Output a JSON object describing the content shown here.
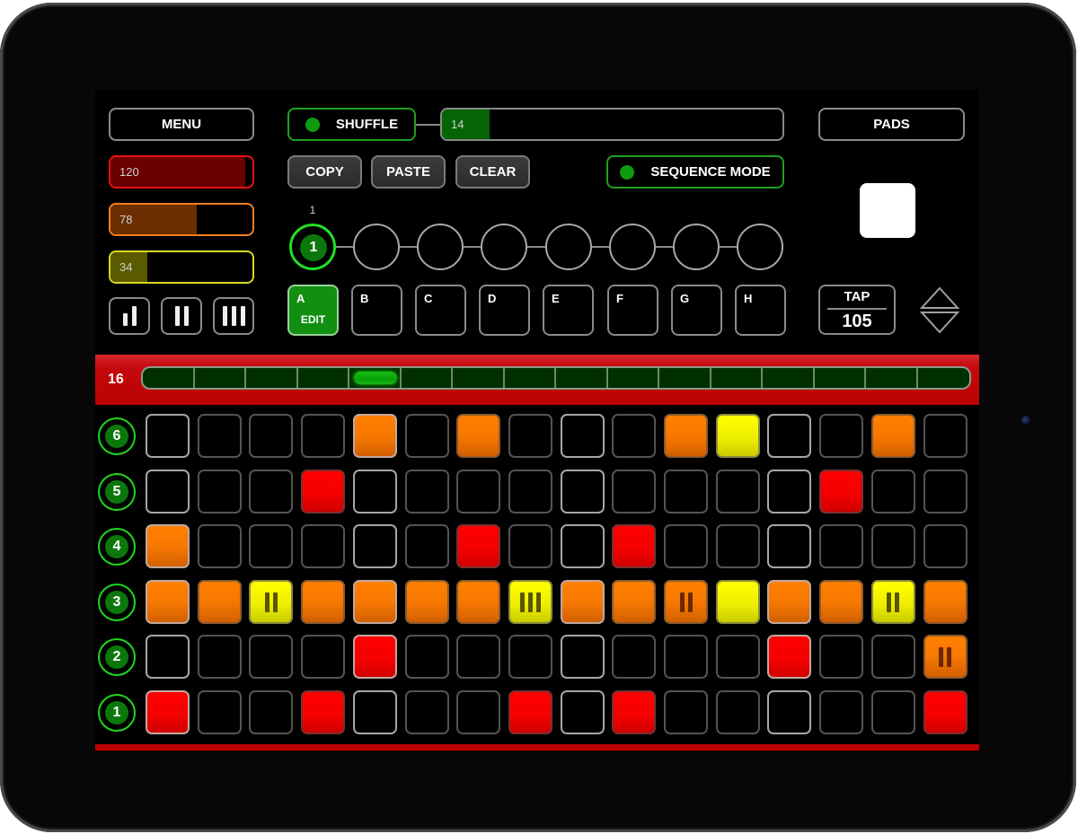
{
  "header": {
    "menu_label": "MENU",
    "pads_label": "PADS",
    "shuffle": {
      "label": "SHUFFLE",
      "on": true,
      "value": "14",
      "fraction": 0.14
    },
    "copy_label": "COPY",
    "paste_label": "PASTE",
    "clear_label": "CLEAR",
    "sequence_mode": {
      "label": "SEQUENCE MODE",
      "on": true
    }
  },
  "sliders": [
    {
      "name": "red",
      "value": "120",
      "fraction": 0.95,
      "border": "#e81010",
      "fill": "#6a0000"
    },
    {
      "name": "orange",
      "value": "78",
      "fraction": 0.61,
      "border": "#f08020",
      "fill": "#6a2e00"
    },
    {
      "name": "yellow",
      "value": "34",
      "fraction": 0.26,
      "border": "#d8d820",
      "fill": "#5a5a00"
    }
  ],
  "voice_buttons": [
    {
      "name": "single",
      "bars": 1
    },
    {
      "name": "double",
      "bars": 2
    },
    {
      "name": "triple",
      "bars": 3
    }
  ],
  "chain": {
    "current_label": "1",
    "slots": [
      "1",
      "",
      "",
      "",
      "",
      "",
      "",
      ""
    ]
  },
  "patterns": {
    "items": [
      "A",
      "B",
      "C",
      "D",
      "E",
      "F",
      "G",
      "H"
    ],
    "active_index": 0,
    "edit_label": "EDIT"
  },
  "tempo": {
    "tap_label": "TAP",
    "bpm": "105"
  },
  "steps": {
    "count_label": "16",
    "total": 16,
    "playhead_index": 4
  },
  "grid": {
    "rows": [
      {
        "label": "6",
        "cells": [
          "",
          "",
          "",
          "",
          "orange",
          "",
          "orange",
          "",
          "",
          "",
          "orange",
          "yellow",
          "",
          "",
          "orange",
          ""
        ],
        "repeats": {}
      },
      {
        "label": "5",
        "cells": [
          "",
          "",
          "",
          "red",
          "",
          "",
          "",
          "",
          "",
          "",
          "",
          "",
          "",
          "red",
          "",
          ""
        ],
        "repeats": {}
      },
      {
        "label": "4",
        "cells": [
          "orange",
          "",
          "",
          "",
          "",
          "",
          "red",
          "",
          "",
          "red",
          "",
          "",
          "",
          "",
          "",
          ""
        ],
        "repeats": {}
      },
      {
        "label": "3",
        "cells": [
          "orange",
          "orange",
          "yellow",
          "orange",
          "orange",
          "orange",
          "orange",
          "yellow",
          "orange",
          "orange",
          "orange",
          "yellow",
          "orange",
          "orange",
          "yellow",
          "orange"
        ],
        "repeats": {
          "2": 2,
          "7": 3,
          "10": 2,
          "14": 2
        }
      },
      {
        "label": "2",
        "cells": [
          "",
          "",
          "",
          "",
          "red",
          "",
          "",
          "",
          "",
          "",
          "",
          "",
          "red",
          "",
          "",
          "orange"
        ],
        "repeats": {
          "15": 2
        }
      },
      {
        "label": "1",
        "cells": [
          "red",
          "",
          "",
          "red",
          "",
          "",
          "",
          "red",
          "",
          "red",
          "",
          "",
          "",
          "",
          "",
          "red"
        ],
        "repeats": {}
      }
    ]
  },
  "colors": {
    "accent_green": "#1ed81e",
    "red": "#ff0000",
    "orange": "#ff8000",
    "yellow": "#ffff00"
  }
}
